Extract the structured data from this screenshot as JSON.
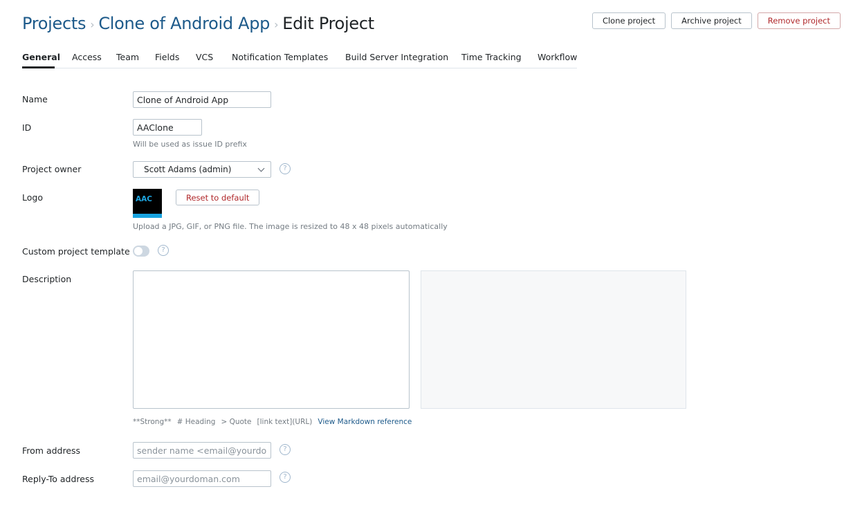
{
  "breadcrumb": {
    "root": "Projects",
    "project": "Clone of Android App",
    "current": "Edit Project"
  },
  "actions": {
    "clone": "Clone project",
    "archive": "Archive project",
    "remove": "Remove project"
  },
  "tabs": [
    "General",
    "Access",
    "Team",
    "Fields",
    "VCS",
    "Notification Templates",
    "Build Server Integration",
    "Time Tracking",
    "Workflow"
  ],
  "active_tab": "General",
  "form": {
    "name": {
      "label": "Name",
      "value": "Clone of Android App"
    },
    "id": {
      "label": "ID",
      "value": "AAClone",
      "hint": "Will be used as issue ID prefix"
    },
    "owner": {
      "label": "Project owner",
      "value": "Scott Adams (admin)"
    },
    "logo": {
      "label": "Logo",
      "text": "AAC",
      "reset_label": "Reset to default",
      "hint": "Upload a JPG, GIF, or PNG file. The image is resized to 48 x 48 pixels automatically"
    },
    "custom_template": {
      "label": "Custom project template",
      "enabled": false
    },
    "description": {
      "label": "Description",
      "value": ""
    },
    "markdown": {
      "strong": "**Strong**",
      "heading": "# Heading",
      "quote": "> Quote",
      "link": "[link text](URL)",
      "reference": "View Markdown reference"
    },
    "from_address": {
      "label": "From address",
      "placeholder": "sender name <email@yourdomain.com>"
    },
    "reply_to": {
      "label": "Reply-To address",
      "placeholder": "email@yourdoman.com"
    }
  },
  "help_glyph": "?",
  "icons": [
    "question-circle-icon",
    "chevron-down-icon"
  ],
  "colors": {
    "link": "#1d5a8a",
    "danger": "#b0282b",
    "logo_accent": "#18a3e0",
    "help": "#9fb6cc"
  }
}
